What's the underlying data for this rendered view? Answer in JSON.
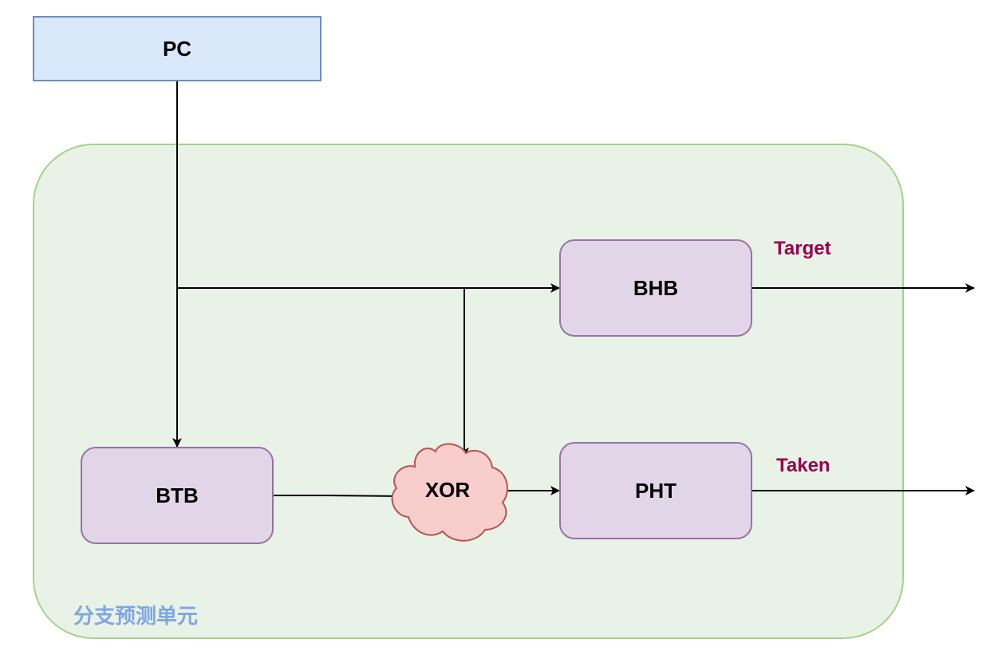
{
  "diagram": {
    "group": {
      "label": "分支预测单元",
      "fill": "#e9f2e6",
      "stroke": "#a9d08e",
      "label_color": "#7ea6e0"
    },
    "nodes": {
      "pc": {
        "label": "PC",
        "fill": "#dae8fc",
        "stroke": "#6c8ebf"
      },
      "bhb": {
        "label": "BHB",
        "fill": "#e1d5e7",
        "stroke": "#9673a6"
      },
      "btb": {
        "label": "BTB",
        "fill": "#e1d5e7",
        "stroke": "#9673a6"
      },
      "pht": {
        "label": "PHT",
        "fill": "#e1d5e7",
        "stroke": "#9673a6"
      },
      "xor": {
        "label": "XOR",
        "fill": "#f8cecc",
        "stroke": "#b85450"
      }
    },
    "outputs": {
      "target": {
        "label": "Target",
        "color": "#99004d"
      },
      "taken": {
        "label": "Taken",
        "color": "#99004d"
      }
    },
    "edges": [
      {
        "from": "pc",
        "to": "btb"
      },
      {
        "from": "pc",
        "to": "bhb"
      },
      {
        "from": "pc",
        "to": "xor"
      },
      {
        "from": "btb",
        "to": "xor"
      },
      {
        "from": "xor",
        "to": "pht"
      },
      {
        "from": "bhb",
        "to": "target"
      },
      {
        "from": "pht",
        "to": "taken"
      }
    ]
  }
}
